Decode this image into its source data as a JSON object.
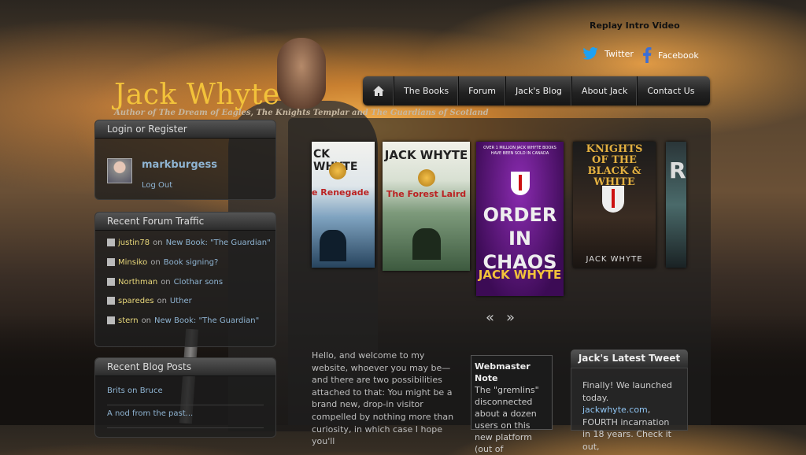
{
  "header": {
    "title": "Jack Whyte",
    "subtitle": "Author of The Dream of Eagles, The Knights Templar and The Guardians of Scotland",
    "replay": "Replay Intro Video",
    "twitter": "Twitter",
    "facebook": "Facebook"
  },
  "nav": {
    "items": [
      "The Books",
      "Forum",
      "Jack's Blog",
      "About Jack",
      "Contact Us"
    ]
  },
  "login": {
    "heading": "Login or Register",
    "username": "markburgess",
    "logout": "Log Out"
  },
  "traffic": {
    "heading": "Recent Forum Traffic",
    "items": [
      {
        "user": "justin78",
        "on": "on",
        "topic": "New Book: \"The Guardian\""
      },
      {
        "user": "Minsiko",
        "on": "on",
        "topic": "Book signing?"
      },
      {
        "user": "Northman",
        "on": "on",
        "topic": "Clothar sons"
      },
      {
        "user": "sparedes",
        "on": "on",
        "topic": "Uther"
      },
      {
        "user": "stern",
        "on": "on",
        "topic": "New Book: \"The Guardian\""
      }
    ]
  },
  "blog": {
    "heading": "Recent Blog Posts",
    "items": [
      "Brits on Bruce",
      "A nod from the past..."
    ]
  },
  "books": [
    {
      "title": "CK WHYTE",
      "sub": "e Renegade"
    },
    {
      "title": "JACK WHYTE",
      "sub": "The Forest Laird"
    },
    {
      "top": "OVER 1 MILLION JACK WHYTE BOOKS HAVE BEEN SOLD IN CANADA",
      "title": "ORDER IN CHAOS",
      "sub": "JACK WHYTE"
    },
    {
      "title": "KNIGHTS OF THE BLACK & WHITE",
      "sub": "JACK WHYTE"
    },
    {
      "title": "R"
    }
  ],
  "carousel": {
    "prev": "«",
    "next": "»"
  },
  "intro": "Hello, and welcome to my website, whoever you may be—and there are two possibilities attached to that: You might be a brand new, drop-in visitor compelled by nothing more than curiosity, in which case I hope you'll",
  "webmaster": {
    "heading": "Webmaster Note",
    "text": "The \"gremlins\" disconnected about a dozen users on this new platform (out of"
  },
  "tweet": {
    "heading": "Jack's Latest Tweet",
    "pre": "Finally! We launched today. ",
    "link": "jackwhyte.com",
    "post": ", FOURTH incarnation in 18 years. Check it out,"
  }
}
